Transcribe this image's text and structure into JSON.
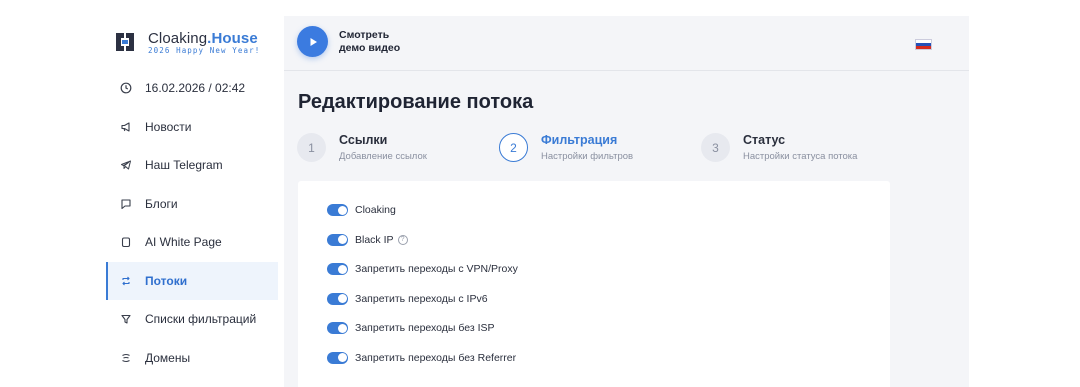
{
  "brand": {
    "name_part1": "Cloaking",
    "name_dot": ".",
    "name_part2": "House",
    "subtitle": "2026 Happy New Year!",
    "accent_color": "#3a7bd5"
  },
  "sidebar": {
    "datetime": "16.02.2026 / 02:42",
    "items": [
      {
        "label": "Новости",
        "icon": "megaphone-icon"
      },
      {
        "label": "Наш Telegram",
        "icon": "telegram-icon"
      },
      {
        "label": "Блоги",
        "icon": "chat-bubble-icon"
      },
      {
        "label": "AI White Page",
        "icon": "page-icon"
      },
      {
        "label": "Потоки",
        "icon": "flows-icon",
        "active": true
      },
      {
        "label": "Списки фильтраций",
        "icon": "filter-icon"
      },
      {
        "label": "Домены",
        "icon": "domains-icon"
      }
    ]
  },
  "topbar": {
    "demo_line1": "Смотреть",
    "demo_line2": "демо видео",
    "language_flag": "russia-flag-icon"
  },
  "page": {
    "title": "Редактирование потока"
  },
  "steps": [
    {
      "num": "1",
      "title": "Ссылки",
      "subtitle": "Добавление ссылок"
    },
    {
      "num": "2",
      "title": "Фильтрация",
      "subtitle": "Настройки фильтров",
      "active": true
    },
    {
      "num": "3",
      "title": "Статус",
      "subtitle": "Настройки статуса потока"
    }
  ],
  "filters": [
    {
      "label": "Cloaking",
      "enabled": true
    },
    {
      "label": "Black IP",
      "enabled": true,
      "help": "?"
    },
    {
      "label": "Запретить переходы с VPN/Proxy",
      "enabled": true
    },
    {
      "label": "Запретить переходы с IPv6",
      "enabled": true
    },
    {
      "label": "Запретить переходы без ISP",
      "enabled": true
    },
    {
      "label": "Запретить переходы без Referrer",
      "enabled": true
    }
  ]
}
